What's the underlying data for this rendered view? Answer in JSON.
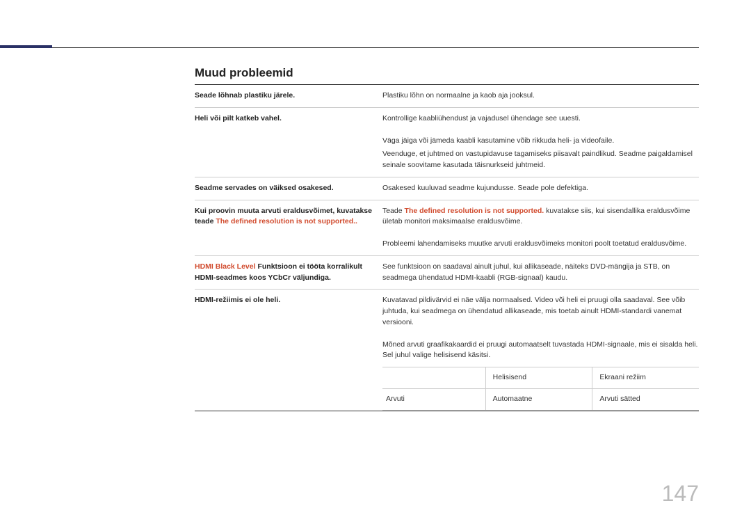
{
  "section_title": "Muud probleemid",
  "rows": {
    "r1": {
      "left": "Seade lõhnab plastiku järele.",
      "right": "Plastiku lõhn on normaalne ja kaob aja jooksul."
    },
    "r2": {
      "left": "Heli või pilt katkeb vahel.",
      "right1": "Kontrollige kaabliühendust ja vajadusel ühendage see uuesti.",
      "right2": "Väga jäiga või jämeda kaabli kasutamine võib rikkuda heli- ja videofaile.",
      "right3": "Veenduge, et juhtmed on vastupidavuse tagamiseks piisavalt paindlikud. Seadme paigaldamisel seinale soovitame kasutada täisnurkseid juhtmeid."
    },
    "r3": {
      "left": "Seadme servades on väiksed osakesed.",
      "right": "Osakesed kuuluvad seadme kujundusse. Seade pole defektiga."
    },
    "r4": {
      "left1": "Kui proovin muuta arvuti eraldusvõimet, kuvatakse teade ",
      "left_red": "The defined resolution is not supported..",
      "right1a": "Teade ",
      "right1_red": "The defined resolution is not supported.",
      "right1b": " kuvatakse siis, kui sisendallika eraldusvõime ületab monitori maksimaalse eraldusvõime.",
      "right2": "Probleemi lahendamiseks muutke arvuti eraldusvõimeks monitori poolt toetatud eraldusvõime."
    },
    "r5": {
      "left_red": "HDMI Black Level",
      "left_rest": " Funktsioon ei tööta korralikult HDMI-seadmes koos YCbCr väljundiga.",
      "right": "See funktsioon on saadaval ainult juhul, kui allikaseade, näiteks DVD-mängija ja STB, on seadmega ühendatud HDMI-kaabli (RGB-signaal) kaudu."
    },
    "r6": {
      "left": "HDMI-režiimis ei ole heli.",
      "right1": "Kuvatavad pildivärvid ei näe välja normaalsed. Video või heli ei pruugi olla saadaval. See võib juhtuda, kui seadmega on ühendatud allikaseade, mis toetab ainult HDMI-standardi vanemat versiooni.",
      "right2": "Mõned arvuti graafikakaardid ei pruugi automaatselt tuvastada HDMI-signaale, mis ei sisalda heli. Sel juhul valige helisisend käsitsi."
    }
  },
  "sub_table": {
    "header": {
      "c1": "",
      "c2": "Helisisend",
      "c3": "Ekraani režiim"
    },
    "row1": {
      "c1": "Arvuti",
      "c2": "Automaatne",
      "c3": "Arvuti sätted"
    }
  },
  "page_number": "147"
}
